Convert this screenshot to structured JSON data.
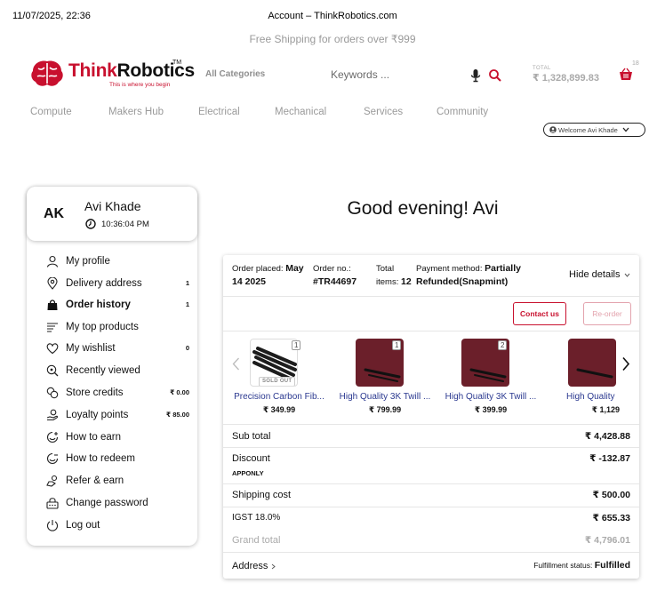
{
  "print": {
    "date": "11/07/2025, 22:36",
    "title": "Account – ThinkRobotics.com"
  },
  "topbar": {
    "shipping": "Free Shipping for orders over ₹999"
  },
  "logo": {
    "think": "Think",
    "robotics": "Robotics",
    "tm": "TM",
    "tagline": "This is where you begin"
  },
  "header": {
    "all_categories": "All Categories",
    "search_placeholder": "Keywords ...",
    "total_label": "TOTAL",
    "total_value": "₹ 1,328,899.83",
    "cart_count": "18"
  },
  "nav": [
    "Compute",
    "Makers Hub",
    "Electrical",
    "Mechanical",
    "Services",
    "Community"
  ],
  "welcome": "Welcome Avi Khade",
  "profile": {
    "initials": "AK",
    "name": "Avi Khade",
    "time": "10:36:04 PM"
  },
  "menu": [
    {
      "label": "My profile",
      "badge": "",
      "icon": "user-icon"
    },
    {
      "label": "Delivery address",
      "badge": "1",
      "icon": "location-pin-icon"
    },
    {
      "label": "Order history",
      "badge": "1",
      "icon": "shopping-bag-icon"
    },
    {
      "label": "My top products",
      "badge": "",
      "icon": "list-icon"
    },
    {
      "label": "My wishlist",
      "badge": "0",
      "icon": "heart-icon"
    },
    {
      "label": "Recently viewed",
      "badge": "",
      "icon": "magnifier-eye-icon"
    },
    {
      "label": "Store credits",
      "badge": "₹ 0.00",
      "icon": "coins-icon"
    },
    {
      "label": "Loyalty points",
      "badge": "₹ 85.00",
      "icon": "hand-coin-icon"
    },
    {
      "label": "How to earn",
      "badge": "",
      "icon": "smiley-plus-icon"
    },
    {
      "label": "How to redeem",
      "badge": "",
      "icon": "smiley-minus-icon"
    },
    {
      "label": "Refer & earn",
      "badge": "",
      "icon": "share-hand-icon"
    },
    {
      "label": "Change password",
      "badge": "",
      "icon": "password-icon"
    },
    {
      "label": "Log out",
      "badge": "",
      "icon": "power-icon"
    }
  ],
  "greeting": "Good evening! Avi",
  "order": {
    "placed_label": "Order placed:",
    "placed_value_a": "May",
    "placed_value_b": "14 2025",
    "no_label": "Order no.:",
    "no_value": "#TR44697",
    "total_label_a": "Total",
    "total_label_b": "items:",
    "total_value": "12",
    "payment_label": "Payment method:",
    "payment_value_a": "Partially",
    "payment_value_b": "Refunded(Snapmint)",
    "hide_details": "Hide details",
    "contact_us": "Contact us",
    "reorder": "Re-order",
    "products": [
      {
        "name": "Precision Carbon Fib...",
        "price": "₹ 349.99",
        "qty": "1",
        "soldout": "SOLD OUT"
      },
      {
        "name": "High Quality 3K Twill ...",
        "price": "₹ 799.99",
        "qty": "1",
        "soldout": ""
      },
      {
        "name": "High Quality 3K Twill ...",
        "price": "₹ 399.99",
        "qty": "2",
        "soldout": ""
      },
      {
        "name": "High Quality",
        "price": "₹ 1,129",
        "qty": "",
        "soldout": ""
      }
    ],
    "summary": {
      "subtotal_label": "Sub total",
      "subtotal_value": "₹ 4,428.88",
      "discount_label": "Discount",
      "discount_code": "APPONLY",
      "discount_value": "₹ -132.87",
      "shipping_label": "Shipping cost",
      "shipping_value": "₹ 500.00",
      "igst_label": "IGST 18.0%",
      "igst_value": "₹ 655.33",
      "grand_label": "Grand total",
      "grand_value": "₹ 4,796.01",
      "address_label": "Address",
      "fulfillment_label": "Fulfillment status:",
      "fulfillment_value": "Fulfilled"
    }
  },
  "colors": {
    "brand": "#c8102e",
    "link": "#2b3990",
    "muted": "#9a9a9a"
  }
}
